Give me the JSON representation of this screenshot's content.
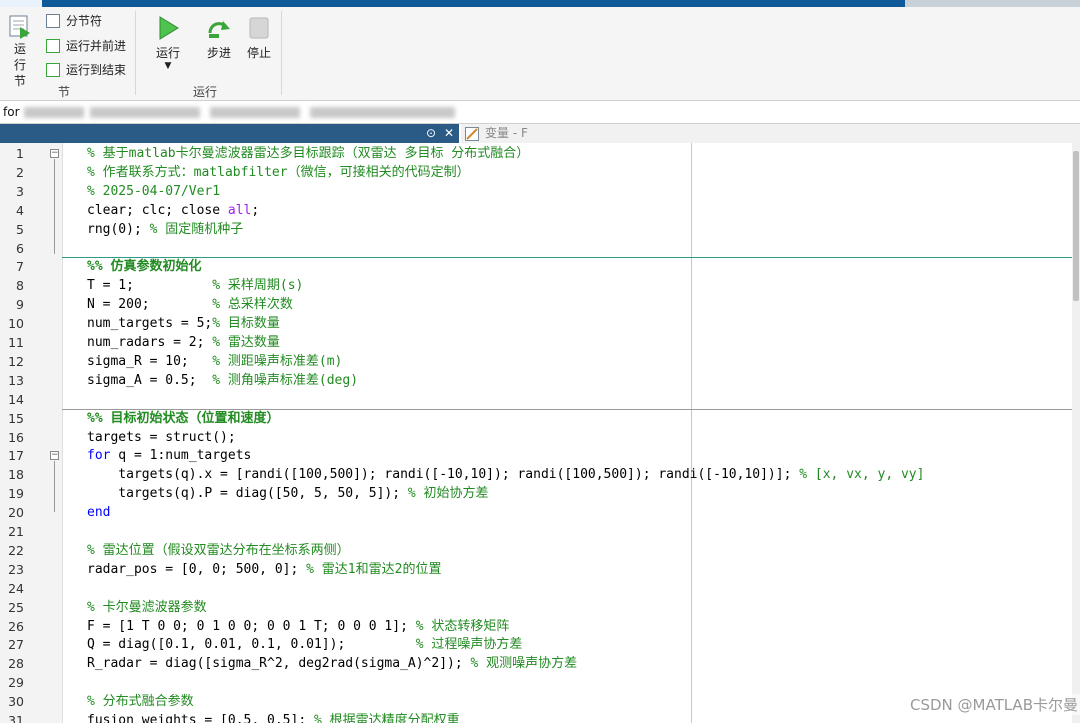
{
  "toolbar": {
    "run_section_label": "运行节",
    "section_break_label": "分节符",
    "run_advance_label": "运行并前进",
    "run_to_end_label": "运行到结束",
    "section_group_label": "节",
    "run_label": "运行",
    "step_label": "步进",
    "stop_label": "停止",
    "run_group_label": "运行"
  },
  "address": {
    "prefix": "for"
  },
  "tabs": {
    "variables_tab_label": "变量 - F"
  },
  "editor": {
    "lines": [
      {
        "n": "1",
        "parts": [
          {
            "t": "% 基于matlab卡尔曼滤波器雷达多目标跟踪（双雷达 多目标 分布式融合）",
            "c": "cm"
          }
        ],
        "fold": "minus"
      },
      {
        "n": "2",
        "parts": [
          {
            "t": "% 作者联系方式：matlabfilter（微信，可接相关的代码定制）",
            "c": "cm"
          }
        ]
      },
      {
        "n": "3",
        "parts": [
          {
            "t": "% 2025-04-07/Ver1",
            "c": "cm"
          }
        ]
      },
      {
        "n": "4",
        "parts": [
          {
            "t": "clear; clc; close ",
            "c": ""
          },
          {
            "t": "all",
            "c": "str"
          },
          {
            "t": ";",
            "c": ""
          }
        ]
      },
      {
        "n": "5",
        "parts": [
          {
            "t": "rng(0); ",
            "c": ""
          },
          {
            "t": "% 固定随机种子",
            "c": "cm"
          }
        ]
      },
      {
        "n": "6",
        "parts": []
      },
      {
        "n": "7",
        "parts": [
          {
            "t": "%% 仿真参数初始化",
            "c": "sec"
          }
        ]
      },
      {
        "n": "8",
        "parts": [
          {
            "t": "T = 1;          ",
            "c": ""
          },
          {
            "t": "% 采样周期(s)",
            "c": "cm"
          }
        ]
      },
      {
        "n": "9",
        "parts": [
          {
            "t": "N = 200;        ",
            "c": ""
          },
          {
            "t": "% 总采样次数",
            "c": "cm"
          }
        ]
      },
      {
        "n": "10",
        "parts": [
          {
            "t": "num_targets = 5;",
            "c": ""
          },
          {
            "t": "% 目标数量",
            "c": "cm"
          }
        ]
      },
      {
        "n": "11",
        "parts": [
          {
            "t": "num_radars = 2; ",
            "c": ""
          },
          {
            "t": "% 雷达数量",
            "c": "cm"
          }
        ]
      },
      {
        "n": "12",
        "parts": [
          {
            "t": "sigma_R = 10;   ",
            "c": ""
          },
          {
            "t": "% 测距噪声标准差(m)",
            "c": "cm"
          }
        ]
      },
      {
        "n": "13",
        "parts": [
          {
            "t": "sigma_A = 0.5;  ",
            "c": ""
          },
          {
            "t": "% 测角噪声标准差(deg)",
            "c": "cm"
          }
        ]
      },
      {
        "n": "14",
        "parts": []
      },
      {
        "n": "15",
        "parts": [
          {
            "t": "%% 目标初始状态（位置和速度）",
            "c": "sec"
          }
        ]
      },
      {
        "n": "16",
        "parts": [
          {
            "t": "targets = struct();",
            "c": ""
          }
        ]
      },
      {
        "n": "17",
        "parts": [
          {
            "t": "for",
            "c": "kw"
          },
          {
            "t": " q = 1:num_targets",
            "c": ""
          }
        ],
        "fold": "minus"
      },
      {
        "n": "18",
        "parts": [
          {
            "t": "    targets(q).x = [randi([100,500]); randi([-10,10]); randi([100,500]); randi([-10,10])]; ",
            "c": ""
          },
          {
            "t": "% [x, vx, y, vy]",
            "c": "cm"
          }
        ]
      },
      {
        "n": "19",
        "parts": [
          {
            "t": "    targets(q).P = diag([50, 5, 50, 5]); ",
            "c": ""
          },
          {
            "t": "% 初始协方差",
            "c": "cm"
          }
        ]
      },
      {
        "n": "20",
        "parts": [
          {
            "t": "end",
            "c": "kw"
          }
        ]
      },
      {
        "n": "21",
        "parts": []
      },
      {
        "n": "22",
        "parts": [
          {
            "t": "% 雷达位置（假设双雷达分布在坐标系两侧）",
            "c": "cm"
          }
        ]
      },
      {
        "n": "23",
        "parts": [
          {
            "t": "radar_pos = [0, 0; 500, 0]; ",
            "c": ""
          },
          {
            "t": "% 雷达1和雷达2的位置",
            "c": "cm"
          }
        ]
      },
      {
        "n": "24",
        "parts": []
      },
      {
        "n": "25",
        "parts": [
          {
            "t": "% 卡尔曼滤波器参数",
            "c": "cm"
          }
        ]
      },
      {
        "n": "26",
        "parts": [
          {
            "t": "F = [1 T 0 0; 0 1 0 0; 0 0 1 T; 0 0 0 1]; ",
            "c": ""
          },
          {
            "t": "% 状态转移矩阵",
            "c": "cm"
          }
        ]
      },
      {
        "n": "27",
        "parts": [
          {
            "t": "Q = diag([0.1, 0.01, 0.1, 0.01]);         ",
            "c": ""
          },
          {
            "t": "% 过程噪声协方差",
            "c": "cm"
          }
        ]
      },
      {
        "n": "28",
        "parts": [
          {
            "t": "R_radar = diag([sigma_R^2, deg2rad(sigma_A)^2]); ",
            "c": ""
          },
          {
            "t": "% 观测噪声协方差",
            "c": "cm"
          }
        ]
      },
      {
        "n": "29",
        "parts": []
      },
      {
        "n": "30",
        "parts": [
          {
            "t": "% 分布式融合参数",
            "c": "cm"
          }
        ]
      },
      {
        "n": "31",
        "parts": [
          {
            "t": "fusion_weights = [0.5, 0.5]; ",
            "c": ""
          },
          {
            "t": "% 根据雷达精度分配权重",
            "c": "cm"
          }
        ]
      }
    ]
  },
  "watermark": "CSDN @MATLAB卡尔曼"
}
